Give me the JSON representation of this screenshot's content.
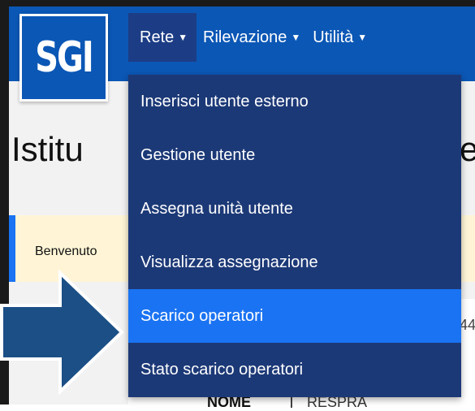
{
  "app": {
    "logo": "SGI"
  },
  "nav": {
    "items": [
      {
        "label": "Rete",
        "caret": "▼"
      },
      {
        "label": "Rilevazione",
        "caret": "▼"
      },
      {
        "label": "Utilità",
        "caret": "▼"
      }
    ]
  },
  "dropdown": {
    "items": [
      {
        "label": "Inserisci utente esterno"
      },
      {
        "label": "Gestione utente"
      },
      {
        "label": "Assegna unità utente"
      },
      {
        "label": "Visualizza assegnazione"
      },
      {
        "label": "Scarico operatori"
      },
      {
        "label": "Stato scarico operatori"
      }
    ],
    "highlighted_index": 4
  },
  "page": {
    "title_visible": "Istitu",
    "title_tail": "e"
  },
  "welcome": {
    "text": "Benvenuto"
  },
  "table": {
    "header": "NOME",
    "value": "RESPRA",
    "side_fragment": "44"
  },
  "colors": {
    "topbar": "#0b57b5",
    "dropdown": "#1c3977",
    "highlight": "#1a73f2",
    "arrow": "#1b4f86",
    "welcome_bg": "#fff5d6"
  },
  "annotations": {
    "arrow": "pointer-arrow-icon"
  }
}
